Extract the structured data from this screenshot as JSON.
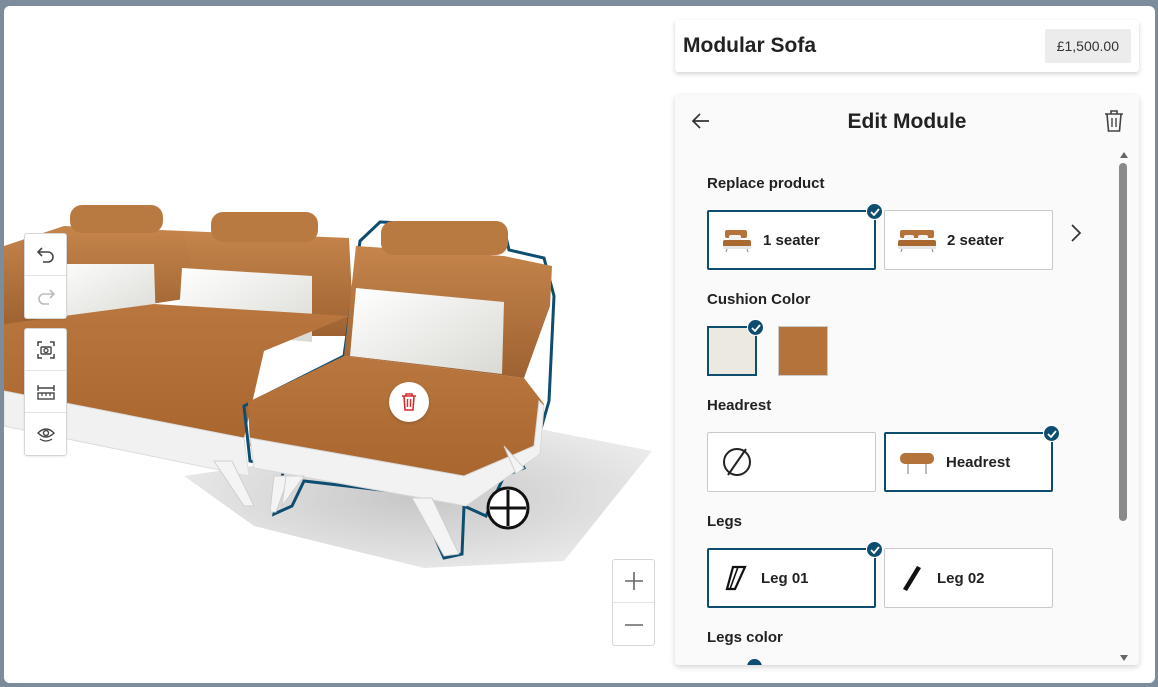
{
  "product": {
    "title": "Modular Sofa",
    "price": "£1,500.00"
  },
  "panel": {
    "title": "Edit Module",
    "sections": {
      "replace": {
        "label": "Replace product",
        "options": [
          {
            "label": "1 seater",
            "selected": true
          },
          {
            "label": "2 seater",
            "selected": false
          }
        ]
      },
      "cushion": {
        "label": "Cushion Color",
        "swatches": [
          {
            "name": "cream",
            "color": "#ece9e0",
            "selected": true
          },
          {
            "name": "tan",
            "color": "#b3733b",
            "selected": false
          }
        ]
      },
      "headrest": {
        "label": "Headrest",
        "options": [
          {
            "label": "",
            "icon": "none-icon",
            "selected": false
          },
          {
            "label": "Headrest",
            "selected": true
          }
        ]
      },
      "legs": {
        "label": "Legs",
        "options": [
          {
            "label": "Leg 01",
            "selected": true
          },
          {
            "label": "Leg 02",
            "selected": false
          }
        ]
      },
      "legs_color": {
        "label": "Legs color"
      }
    }
  },
  "colors": {
    "accent": "#0f4d70",
    "delete": "#d32f2f",
    "sofa_leather": "#b3733b",
    "sofa_base": "#f1f1f1"
  },
  "toolbar_icons": [
    "undo-icon",
    "redo-icon",
    "screenshot-icon",
    "measure-icon",
    "view-icon"
  ],
  "zoom_icons": [
    "zoom-in-icon",
    "zoom-out-icon"
  ]
}
